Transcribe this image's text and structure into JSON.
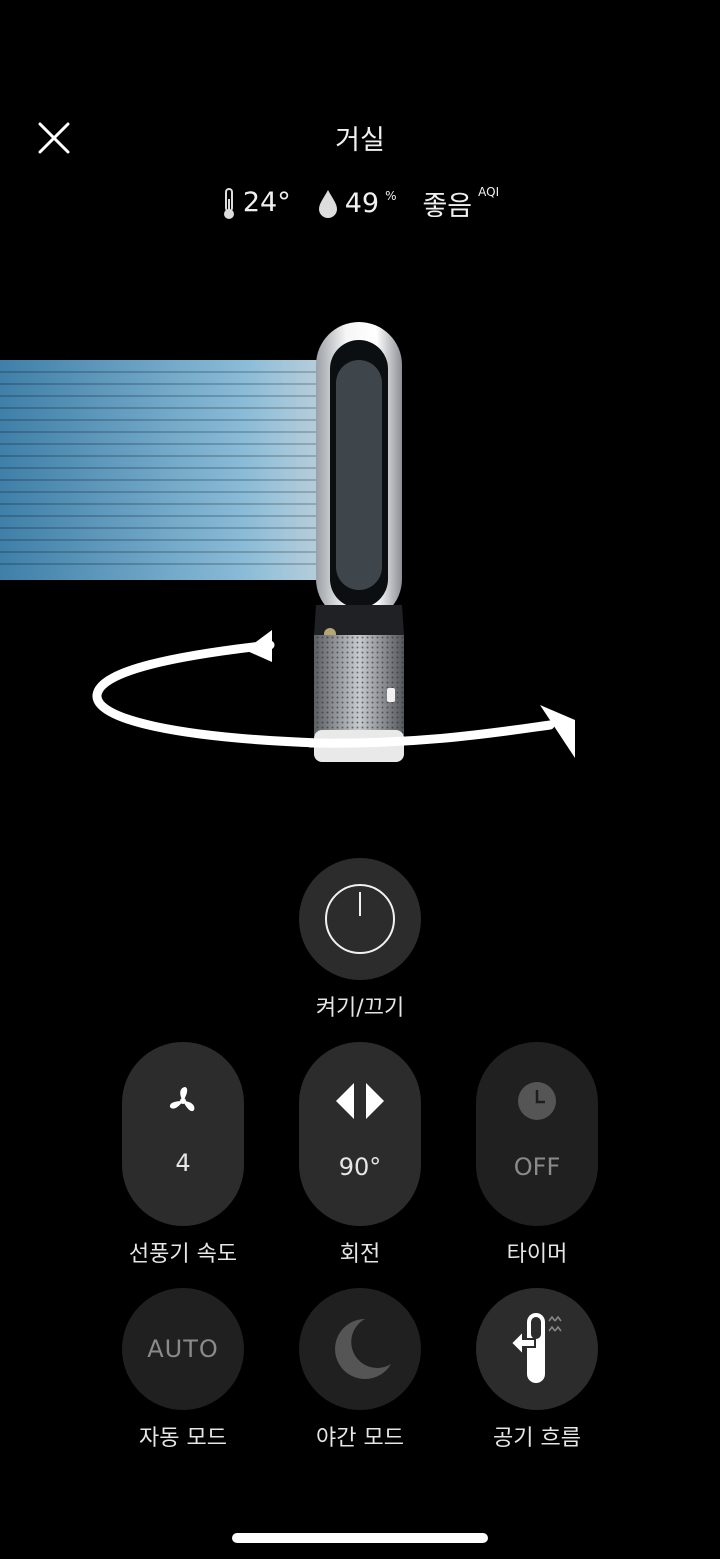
{
  "header": {
    "title": "거실",
    "temperature": "24°",
    "humidity": "49",
    "humidity_unit": "%",
    "air_quality": "좋음",
    "air_quality_unit": "AQI"
  },
  "controls": {
    "power": {
      "label": "켜기/끄기"
    },
    "fan_speed": {
      "value": "4",
      "label": "선풍기 속도"
    },
    "oscillation": {
      "value": "90°",
      "label": "회전"
    },
    "timer": {
      "value": "OFF",
      "label": "타이머"
    },
    "auto_mode": {
      "value": "AUTO",
      "label": "자동 모드"
    },
    "night_mode": {
      "label": "야간 모드"
    },
    "airflow": {
      "label": "공기 흐름"
    }
  },
  "icons": [
    "close-icon",
    "thermometer-icon",
    "humidity-drop-icon",
    "power-icon",
    "fan-icon",
    "oscillation-icon",
    "timer-icon",
    "moon-icon",
    "airflow-icon"
  ]
}
